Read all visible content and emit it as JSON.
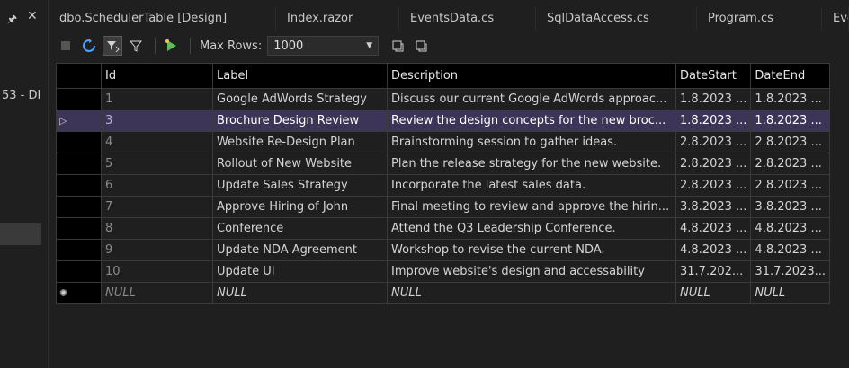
{
  "panel": {
    "left_text": "53 - DI"
  },
  "tabs": [
    {
      "label": "dbo.SchedulerTable [Design]"
    },
    {
      "label": "Index.razor"
    },
    {
      "label": "EventsData.cs"
    },
    {
      "label": "SqlDataAccess.cs"
    },
    {
      "label": "Program.cs"
    },
    {
      "label": "Eve"
    }
  ],
  "toolbar": {
    "max_rows_label": "Max Rows:",
    "max_rows_value": "1000"
  },
  "grid": {
    "columns": [
      "Id",
      "Label",
      "Description",
      "DateStart",
      "DateEnd"
    ],
    "rows": [
      {
        "id": "1",
        "label": "Google AdWords Strategy",
        "description": "Discuss our current Google AdWords approac...",
        "start": "1.8.2023 ...",
        "end": "1.8.2023 ..."
      },
      {
        "id": "3",
        "label": "Brochure Design Review",
        "description": "Review the design concepts for the new broc...",
        "start": "1.8.2023 ...",
        "end": "1.8.2023 ..."
      },
      {
        "id": "4",
        "label": "Website Re-Design Plan",
        "description": "Brainstorming session to gather ideas.",
        "start": "2.8.2023 ...",
        "end": "2.8.2023 ..."
      },
      {
        "id": "5",
        "label": "Rollout of New Website",
        "description": "Plan the release strategy for the new website.",
        "start": "2.8.2023 ...",
        "end": "2.8.2023 ..."
      },
      {
        "id": "6",
        "label": "Update Sales Strategy",
        "description": "Incorporate the latest sales data.",
        "start": "2.8.2023 ...",
        "end": "2.8.2023 ..."
      },
      {
        "id": "7",
        "label": "Approve Hiring of John",
        "description": "Final meeting to review and approve the hirin...",
        "start": "3.8.2023 ...",
        "end": "3.8.2023 ..."
      },
      {
        "id": "8",
        "label": "Conference",
        "description": "Attend the Q3 Leadership Conference.",
        "start": "4.8.2023 ...",
        "end": "4.8.2023 ..."
      },
      {
        "id": "9",
        "label": "Update NDA Agreement",
        "description": "Workshop to revise the current NDA.",
        "start": "4.8.2023 ...",
        "end": "4.8.2023 ..."
      },
      {
        "id": "10",
        "label": "Update UI",
        "description": "Improve website's design and accessability",
        "start": "31.7.202...",
        "end": "31.7.2023..."
      }
    ],
    "null_row": {
      "id": "NULL",
      "label": "NULL",
      "description": "NULL",
      "start": "NULL",
      "end": "NULL"
    }
  }
}
